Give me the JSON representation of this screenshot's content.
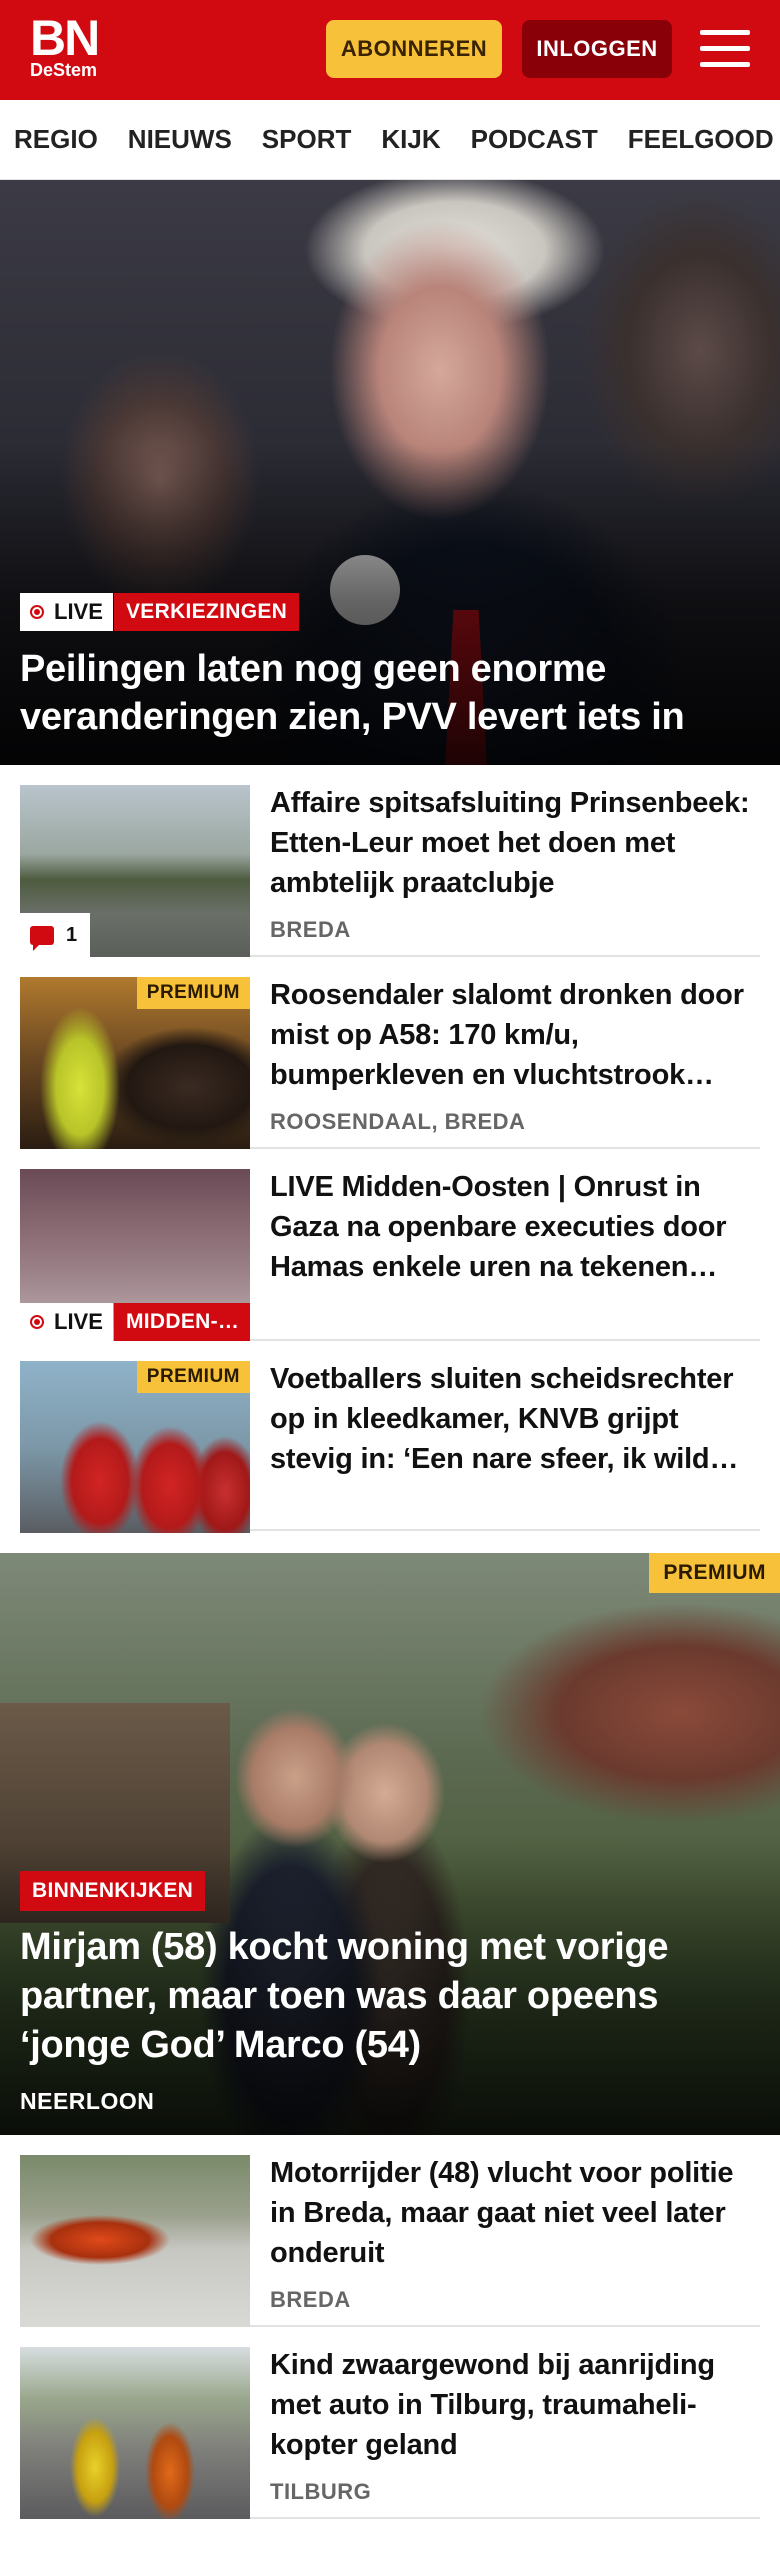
{
  "header": {
    "logo_big": "BN",
    "logo_small": "DeStem",
    "subscribe_label": "ABONNEREN",
    "login_label": "INLOGGEN",
    "colors": {
      "brand": "#d10a11",
      "subscribe": "#f7c23a",
      "login": "#8a0008"
    }
  },
  "nav": {
    "items": [
      "REGIO",
      "NIEUWS",
      "SPORT",
      "KIJK",
      "PODCAST",
      "FEELGOOD"
    ]
  },
  "hero": {
    "live_label": "LIVE",
    "tag": "VERKIEZINGEN",
    "title": "Peilingen laten nog geen enorme veranderingen zien, PVV levert iets in"
  },
  "articles": [
    {
      "title": "Affaire spitsafsluiting Prinsen­beek: Etten-Leur moet het doen met ambtelijk praatclubje",
      "location": "BREDA",
      "comments": "1"
    },
    {
      "title": "Roosendaler slalomt dronken door mist op A58: 170 km/u, bumperkleven en vluchtstrook…",
      "location": "ROOSENDAAL, BREDA",
      "premium": "PREMIUM"
    },
    {
      "title": "LIVE Midden-Oosten | Onrust in Gaza na openbare executies door Hamas enkele uren na tekenen…",
      "live_label": "LIVE",
      "tag": "MIDDEN-…"
    },
    {
      "title": "Voetballers sluiten scheidsrech­ter op in kleedkamer, KNVB grijpt stevig in: ‘Een nare sfeer, ik wild…",
      "premium": "PREMIUM"
    }
  ],
  "feature": {
    "premium": "PREMIUM",
    "tag": "BINNENKIJKEN",
    "title": "Mirjam (58) kocht woning met vorige partner, maar toen was daar opeens ‘jonge God’ Marco (54)",
    "location": "NEERLOON"
  },
  "articles2": [
    {
      "title": "Motorrijder (48) vlucht voor politie in Breda, maar gaat niet veel later onderuit",
      "location": "BREDA"
    },
    {
      "title": "Kind zwaargewond bij aanrijding met auto in Tilburg, traumaheli­kopter geland",
      "location": "TILBURG"
    }
  ]
}
